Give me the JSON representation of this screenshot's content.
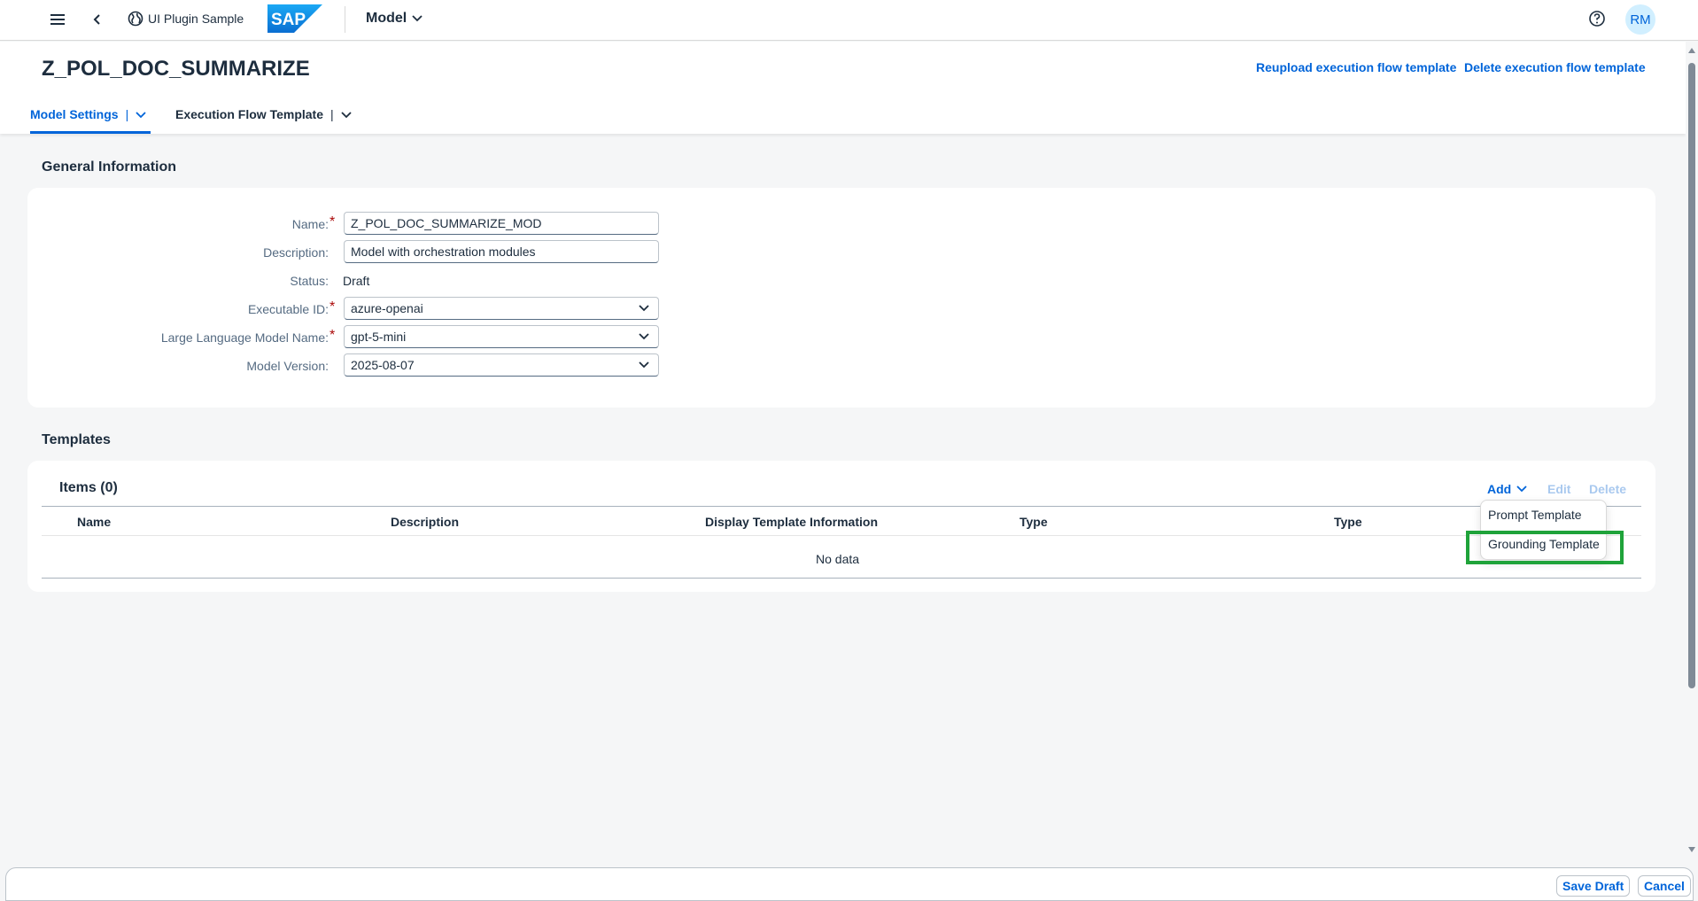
{
  "shell": {
    "app_title": "UI Plugin Sample",
    "logo_text": "SAP",
    "model_menu_label": "Model",
    "avatar_initials": "RM",
    "icons": [
      "menu-icon",
      "back-icon",
      "globe-icon",
      "chevron-down-icon",
      "help-icon"
    ]
  },
  "header": {
    "title": "Z_POL_DOC_SUMMARIZE",
    "actions": {
      "reupload": "Reupload execution flow template",
      "delete": "Delete execution flow template"
    },
    "tabs": [
      {
        "label": "Model Settings",
        "selected": true
      },
      {
        "label": "Execution Flow Template",
        "selected": false
      }
    ],
    "tab_separator": "|"
  },
  "general": {
    "section_title": "General Information",
    "fields": {
      "name": {
        "label": "Name:",
        "value": "Z_POL_DOC_SUMMARIZE_MOD",
        "required": true
      },
      "description": {
        "label": "Description:",
        "value": "Model with orchestration modules",
        "required": false
      },
      "status": {
        "label": "Status:",
        "value": "Draft"
      },
      "executable_id": {
        "label": "Executable ID:",
        "value": "azure-openai",
        "required": true
      },
      "llm_name": {
        "label": "Large Language Model Name:",
        "value": "gpt-5-mini",
        "required": true
      },
      "model_version": {
        "label": "Model Version:",
        "value": "2025-08-07",
        "required": false
      }
    },
    "required_marker": "*"
  },
  "templates": {
    "section_title": "Templates",
    "items_title": "Items (0)",
    "toolbar": {
      "add": "Add",
      "edit": "Edit",
      "delete": "Delete"
    },
    "columns": [
      "Name",
      "Description",
      "Display Template Information",
      "Type",
      "Type"
    ],
    "empty_text": "No data",
    "add_menu": [
      "Prompt Template",
      "Grounding Template"
    ]
  },
  "footer": {
    "save_draft": "Save Draft",
    "cancel": "Cancel"
  },
  "colors": {
    "brand_blue": "#0064d9",
    "highlight_green": "#1fa33a",
    "required_red": "#aa0808"
  }
}
